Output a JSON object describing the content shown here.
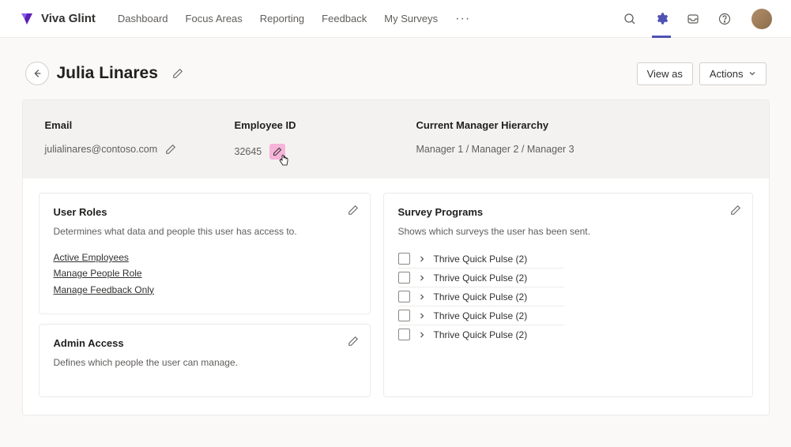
{
  "brand": "Viva Glint",
  "nav": {
    "items": [
      "Dashboard",
      "Focus Areas",
      "Reporting",
      "Feedback",
      "My Surveys"
    ],
    "more": "···"
  },
  "header": {
    "title": "Julia Linares",
    "view_as": "View as",
    "actions": "Actions"
  },
  "info": {
    "email_label": "Email",
    "email_value": "julialinares@contoso.com",
    "eid_label": "Employee ID",
    "eid_value": "32645",
    "mgr_label": "Current Manager Hierarchy",
    "mgr_value": "Manager 1 / Manager 2 / Manager 3"
  },
  "user_roles": {
    "title": "User Roles",
    "desc": "Determines what data and people this user has access to.",
    "links": [
      "Active Employees",
      "Manage People Role",
      "Manage Feedback Only"
    ]
  },
  "admin_access": {
    "title": "Admin Access",
    "desc": "Defines which people the user can manage."
  },
  "survey_programs": {
    "title": "Survey Programs",
    "desc": "Shows which surveys the user has been sent.",
    "items": [
      "Thrive Quick Pulse (2)",
      "Thrive Quick Pulse (2)",
      "Thrive Quick Pulse (2)",
      "Thrive Quick Pulse (2)",
      "Thrive Quick Pulse (2)"
    ]
  }
}
